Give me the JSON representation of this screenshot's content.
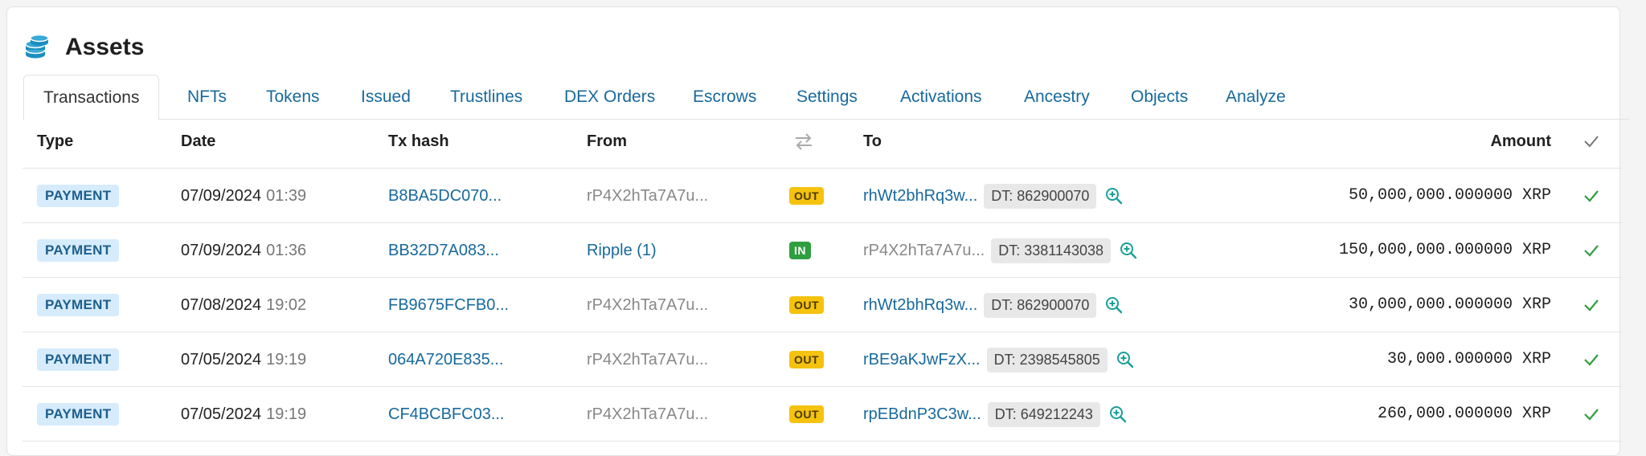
{
  "header": {
    "title": "Assets",
    "icon": "coins-stack-icon",
    "icon_color": "#1a8fbf"
  },
  "tabs": [
    {
      "label": "Transactions",
      "active": true
    },
    {
      "label": "NFTs"
    },
    {
      "label": "Tokens"
    },
    {
      "label": "Issued"
    },
    {
      "label": "Trustlines"
    },
    {
      "label": "DEX Orders"
    },
    {
      "label": "Escrows"
    },
    {
      "label": "Settings"
    },
    {
      "label": "Activations"
    },
    {
      "label": "Ancestry"
    },
    {
      "label": "Objects"
    },
    {
      "label": "Analyze"
    }
  ],
  "table": {
    "columns": {
      "type": "Type",
      "date": "Date",
      "hash": "Tx hash",
      "from": "From",
      "to": "To",
      "amount": "Amount"
    },
    "rows": [
      {
        "type": "PAYMENT",
        "date": "07/09/2024",
        "time": "01:39",
        "hash": "B8BA5DC070...",
        "from": "rP4X2hTa7A7u...",
        "from_link": false,
        "dir": "OUT",
        "to": "rhWt2bhRq3w...",
        "to_link": true,
        "dt": "DT: 862900070",
        "amount": "50,000,000.000000 XRP"
      },
      {
        "type": "PAYMENT",
        "date": "07/09/2024",
        "time": "01:36",
        "hash": "BB32D7A083...",
        "from": "Ripple (1)",
        "from_link": true,
        "dir": "IN",
        "to": "rP4X2hTa7A7u...",
        "to_link": false,
        "dt": "DT: 3381143038",
        "amount": "150,000,000.000000 XRP"
      },
      {
        "type": "PAYMENT",
        "date": "07/08/2024",
        "time": "19:02",
        "hash": "FB9675FCFB0...",
        "from": "rP4X2hTa7A7u...",
        "from_link": false,
        "dir": "OUT",
        "to": "rhWt2bhRq3w...",
        "to_link": true,
        "dt": "DT: 862900070",
        "amount": "30,000,000.000000 XRP"
      },
      {
        "type": "PAYMENT",
        "date": "07/05/2024",
        "time": "19:19",
        "hash": "064A720E835...",
        "from": "rP4X2hTa7A7u...",
        "from_link": false,
        "dir": "OUT",
        "to": "rBE9aKJwFzX...",
        "to_link": true,
        "dt": "DT: 2398545805",
        "amount": "30,000.000000 XRP"
      },
      {
        "type": "PAYMENT",
        "date": "07/05/2024",
        "time": "19:19",
        "hash": "CF4BCBFC03...",
        "from": "rP4X2hTa7A7u...",
        "from_link": false,
        "dir": "OUT",
        "to": "rpEBdnP3C3w...",
        "to_link": true,
        "dt": "DT: 649212243",
        "amount": "260,000.000000 XRP"
      }
    ]
  },
  "colors": {
    "link": "#17699c",
    "out_badge": "#f5c20e",
    "in_badge": "#2e9e3f",
    "check": "#2e9e3f"
  }
}
